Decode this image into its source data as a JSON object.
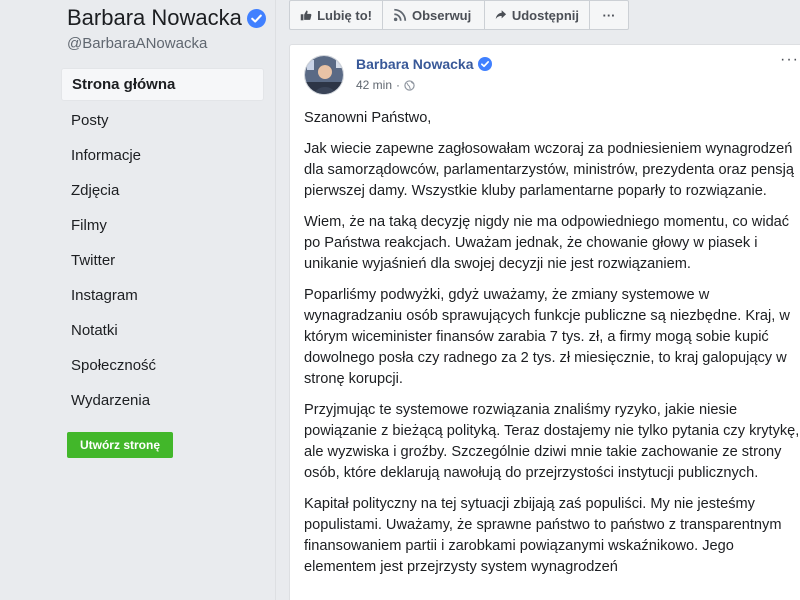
{
  "page": {
    "name": "Barbara Nowacka",
    "handle": "@BarbaraANowacka"
  },
  "nav": {
    "items": [
      {
        "label": "Strona główna"
      },
      {
        "label": "Posty"
      },
      {
        "label": "Informacje"
      },
      {
        "label": "Zdjęcia"
      },
      {
        "label": "Filmy"
      },
      {
        "label": "Twitter"
      },
      {
        "label": "Instagram"
      },
      {
        "label": "Notatki"
      },
      {
        "label": "Społeczność"
      },
      {
        "label": "Wydarzenia"
      }
    ],
    "create_page_label": "Utwórz stronę"
  },
  "toolbar": {
    "like_label": "Lubię to!",
    "follow_label": "Obserwuj",
    "share_label": "Udostępnij",
    "more_label": "···"
  },
  "post": {
    "author": "Barbara Nowacka",
    "time": "42 min",
    "more_label": "···",
    "paragraphs": [
      "Szanowni Państwo,",
      "Jak wiecie zapewne zagłosowałam wczoraj za podniesieniem wynagrodzeń dla samorządowców, parlamentarzystów, ministrów, prezydenta oraz pensją pierwszej damy. Wszystkie kluby parlamentarne poparły to rozwiązanie.",
      "Wiem, że na taką decyzję nigdy nie ma odpowiedniego momentu, co widać po Państwa reakcjach. Uważam jednak, że chowanie głowy w piasek i unikanie wyjaśnień dla swojej decyzji nie jest rozwiązaniem.",
      "Poparliśmy podwyżki, gdyż uważamy, że zmiany systemowe w wynagradzaniu osób sprawujących funkcje publiczne są niezbędne. Kraj, w którym wiceminister finansów zarabia 7 tys. zł, a firmy mogą sobie kupić dowolnego posła czy radnego za 2 tys. zł miesięcznie, to kraj galopujący w stronę korupcji.",
      "Przyjmując te systemowe rozwiązania znaliśmy ryzyko, jakie niesie powiązanie z bieżącą polityką. Teraz dostajemy nie tylko pytania czy krytykę, ale wyzwiska i groźby. Szczególnie dziwi mnie takie zachowanie ze strony osób, które deklarują nawołują do przejrzystości instytucji publicznych.",
      "Kapitał polityczny na tej sytuacji zbijają zaś populiści. My nie jesteśmy populistami. Uważamy, że sprawne państwo to państwo z transparentnym finansowaniem partii i zarobkami powiązanymi wskaźnikowo. Jego elementem jest przejrzysty system wynagrodzeń"
    ]
  },
  "colors": {
    "link_blue": "#385898",
    "verified_blue": "#4080ff",
    "green_button": "#42b72a",
    "background": "#e9ebee"
  }
}
